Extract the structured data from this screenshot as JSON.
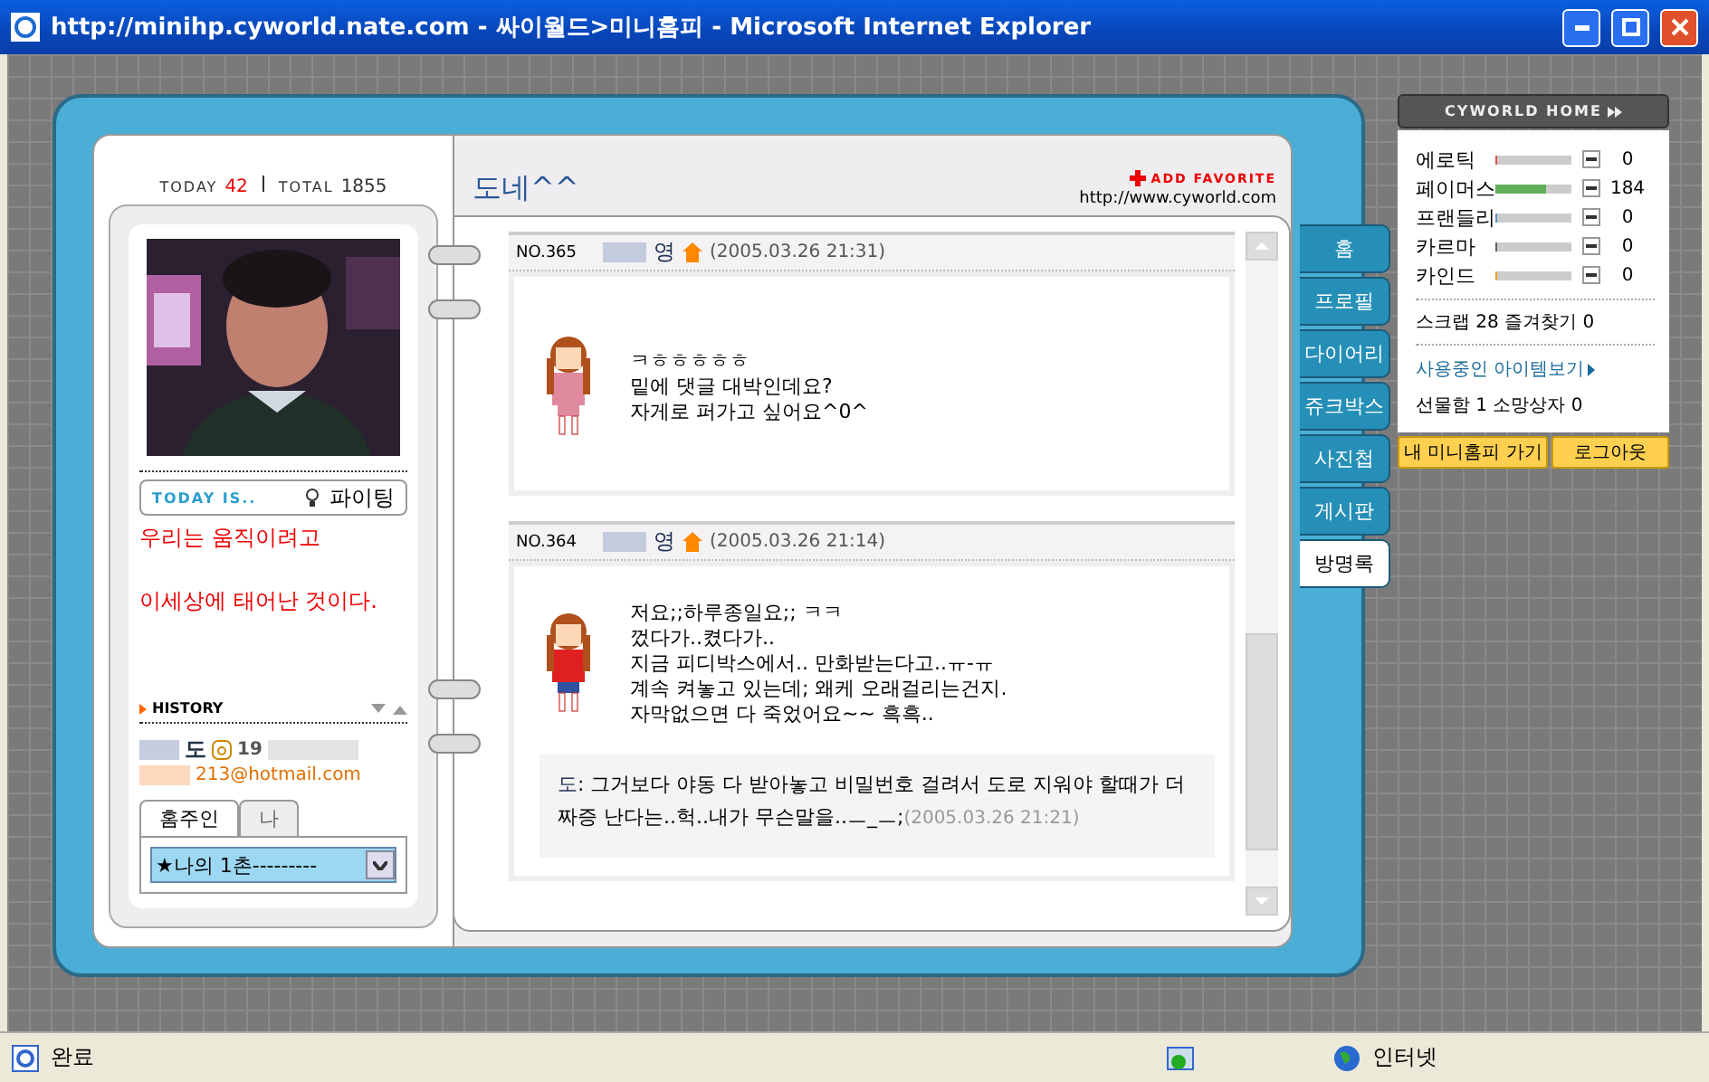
{
  "window": {
    "title": "http://minihp.cyworld.nate.com - 싸이월드>미니홈피 - Microsoft Internet Explorer"
  },
  "left": {
    "today_label": "TODAY",
    "today": "42",
    "total_label": "TOTAL",
    "total": "1855",
    "today_is": "TODAY IS..",
    "mood": "파이팅",
    "status_lines": [
      "우리는 움직이려고",
      "이세상에 태어난 것이다."
    ],
    "history": "HISTORY",
    "owner_name": "도",
    "birth": "19",
    "email": "213@hotmail.com",
    "friend_tabs": [
      {
        "label": "홈주인",
        "selected": true
      },
      {
        "label": "나",
        "selected": false
      }
    ],
    "friend_select": "★나의 1촌---------"
  },
  "right": {
    "title": "도네^^",
    "add_favorite": "ADD FAVORITE",
    "url": "http://www.cyworld.com",
    "entries": [
      {
        "no": "NO.365",
        "author": "영",
        "date": "(2005.03.26 21:31)",
        "text": "ㅋㅎㅎㅎㅎㅎ\n밑에 댓글 대박인데요?\n자게로 퍼가고 싶어요^0^"
      },
      {
        "no": "NO.364",
        "author": "영",
        "date": "(2005.03.26 21:14)",
        "text": "저요;;하루종일요;; ㅋㅋ\n껐다가..켰다가..\n지금 피디박스에서.. 만화받는다고..ㅠ-ㅠ\n계속 켜놓고 있는데; 왜케 오래걸리는건지.\n자막없으면 다 죽었어요~~ 흑흑..",
        "reply": {
          "author": "도",
          "text": ": 그거보다 야동 다 받아놓고 비밀번호 걸려서 도로 지워야 할때가 더 짜증 난다는..헉..내가 무슨말을..ㅡ_ㅡ;",
          "date": "(2005.03.26 21:21)"
        }
      }
    ]
  },
  "nav_tabs": [
    {
      "label": "홈",
      "selected": false
    },
    {
      "label": "프로필",
      "selected": false
    },
    {
      "label": "다이어리",
      "selected": false
    },
    {
      "label": "쥬크박스",
      "selected": false
    },
    {
      "label": "사진첩",
      "selected": false
    },
    {
      "label": "게시판",
      "selected": false
    },
    {
      "label": "방명록",
      "selected": true
    }
  ],
  "side": {
    "home": "CYWORLD HOME",
    "stats": [
      {
        "name": "에로틱",
        "level": 0.02,
        "count": "0",
        "color": "#e05050"
      },
      {
        "name": "페이머스",
        "level": 0.66,
        "count": "184",
        "color": "#5faf5a"
      },
      {
        "name": "프랜들리",
        "level": 0.02,
        "count": "0",
        "color": "#5a8fc8"
      },
      {
        "name": "카르마",
        "level": 0.02,
        "count": "0",
        "color": "#606060"
      },
      {
        "name": "카인드",
        "level": 0.02,
        "count": "0",
        "color": "#f0a020"
      }
    ],
    "scrap": "스크랩 28 즐겨찾기 0",
    "items_link": "사용중인 아이템보기",
    "gifts": "선물함 1 소망상자 0",
    "buttons": [
      "내 미니홈피 가기",
      "로그아웃"
    ]
  },
  "status_bar": {
    "text": "완료",
    "zone": "인터넷"
  }
}
